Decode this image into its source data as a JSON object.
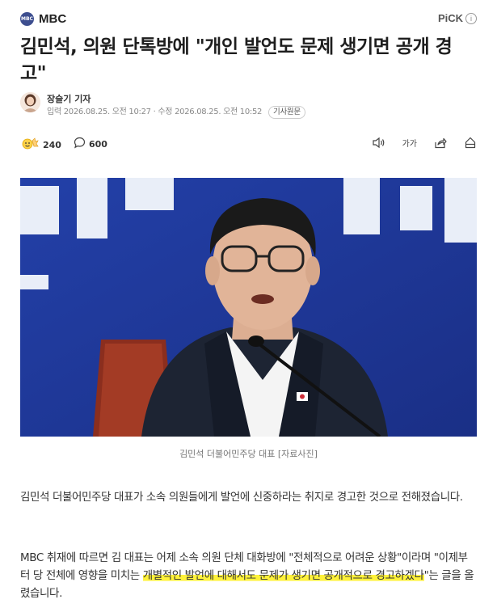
{
  "press": {
    "logo_text": "MBC",
    "name": "MBC",
    "pick_label": "PiCK",
    "pick_info": "i"
  },
  "article": {
    "title": "김민석, 의원 단톡방에 \"개인 발언도 문제 생기면 공개 경고\"",
    "reporter": "장슬기 기자",
    "input_label": "입력",
    "input_time": "2026.08.25. 오전 10:27",
    "separator": "·",
    "modified_label": "수정",
    "modified_time": "2026.08.25. 오전 10:52",
    "original_button": "기사원문"
  },
  "stats": {
    "reactions": "240",
    "comments": "600",
    "font_size_label": "가가"
  },
  "icons": {
    "press_logo": "mbc-logo-icon",
    "info": "info-icon",
    "reaction": "reaction-emoji-icon",
    "comment": "comment-icon",
    "audio": "speaker-icon",
    "font": "font-size-icon",
    "share": "share-icon",
    "print": "print-icon"
  },
  "photo": {
    "caption": "김민석 더불어민주당 대표 [자료사진]"
  },
  "body": {
    "p1": "김민석 더불어민주당 대표가 소속 의원들에게 발언에 신중하라는 취지로 경고한 것으로 전해졌습니다.",
    "p2_a": "MBC 취재에 따르면 김 대표는 어제 소속 의원 단체 대화방에 \"전체적으로 어려운 상황\"이라며 \"이제부터 당 전체에 영향을 미치는 ",
    "p2_highlight": "개별적인 발언에 대해서도 문제가 생기면 공개적으로 경고하겠다",
    "p2_b": "\"는 글을 올렸습니다."
  },
  "colors": {
    "highlight": "#fff23a",
    "photo_background": "#243a9a",
    "text": "#333333"
  }
}
